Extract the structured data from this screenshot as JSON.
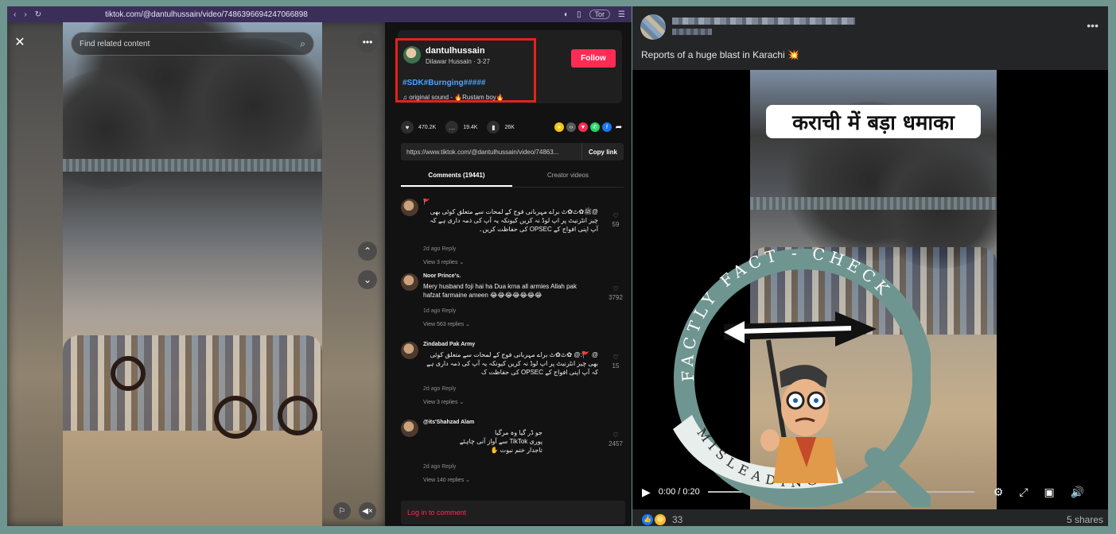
{
  "tiktok": {
    "url": "tiktok.com/@dantulhussain/video/74863966942470​66898",
    "tor_label": "Tor",
    "search_placeholder": "Find related content",
    "close_icon": "close-icon",
    "more_icon": "more-icon",
    "author": {
      "username": "dantulhussain",
      "subline": "Dilawar Hussain · 3-27",
      "hashtags": "#SDK#Burnging#####",
      "sound": "original sound - 🔥Rustam boy🔥",
      "follow_label": "Follow"
    },
    "stats": {
      "likes": "470.2K",
      "comments": "19.4K",
      "saves": "26K"
    },
    "share_colors": [
      "#f5c518",
      "#5a5a5a",
      "#fe2c55",
      "#25d366",
      "#1877f2"
    ],
    "link_url": "https://www.tiktok.com/@dantulhussain/video/74863...",
    "copy_link_label": "Copy link",
    "tabs": {
      "comments": "Comments (19441)",
      "creator": "Creator videos"
    },
    "comments": [
      {
        "name": "🚩",
        "text": "@ﷺ✿ٹ✿ٹ براے مہربانی فوج کے لمحات سے متعلق کوئی بھی چیز انٹرنیٹ پر اپ لوڈ نہ کریں کیونکہ یہ آپ کی ذمہ داری ہے کہ آپ اپنی افواج کے OPSEC کی حفاظت کریں۔",
        "meta": "2d ago   Reply",
        "replies": "View 3 replies ⌄",
        "likes": "59"
      },
      {
        "name": "Noor Prince's.",
        "text": "Mery husband foji hai ha Dua krna all armies Allah pak hafzat farmaine ameen 😂😂😂😂😂😂😂",
        "meta": "1d ago   Reply",
        "replies": "View 563 replies ⌄",
        "likes": "3792"
      },
      {
        "name": "Zindabad Pak Army",
        "text": "@ 🚩:@ ✿ٹ✿ٹ براے مہربانی فوج کے لمحات سے متعلق کوئی بھی چیز انٹرنیٹ پر اپ لوڈ نہ کریں کیونکہ یہ آپ کی ذمہ داری ہے کہ آپ اپنی افواج کے OPSEC کی حفاظت ک",
        "meta": "2d ago   Reply",
        "replies": "View 3 replies ⌄",
        "likes": "15"
      },
      {
        "name": "@its'Shahzad Alam",
        "text": "جو ڈر گیا وہ مرگیا\nپوری TikTok سے آواز آنی چاہئے\nتاجدار ختم نبوت ✋",
        "meta": "2d ago   Reply",
        "replies": "View 140 replies ⌄",
        "likes": "2457"
      }
    ],
    "login_prompt": "Log in to comment"
  },
  "facebook": {
    "author_name": "",
    "author_meta": "",
    "caption": "Reports of a huge blast in Karachi 💥",
    "overlay_text": "कराची में बड़ा धमाका",
    "time": "0:00 / 0:20",
    "reaction_count": "33",
    "shares": "5 shares"
  },
  "watermark": {
    "brand_arc": "FACTLY FACT - CHECK",
    "verdict": "MISLEADING",
    "ring_color": "#6f9590"
  }
}
